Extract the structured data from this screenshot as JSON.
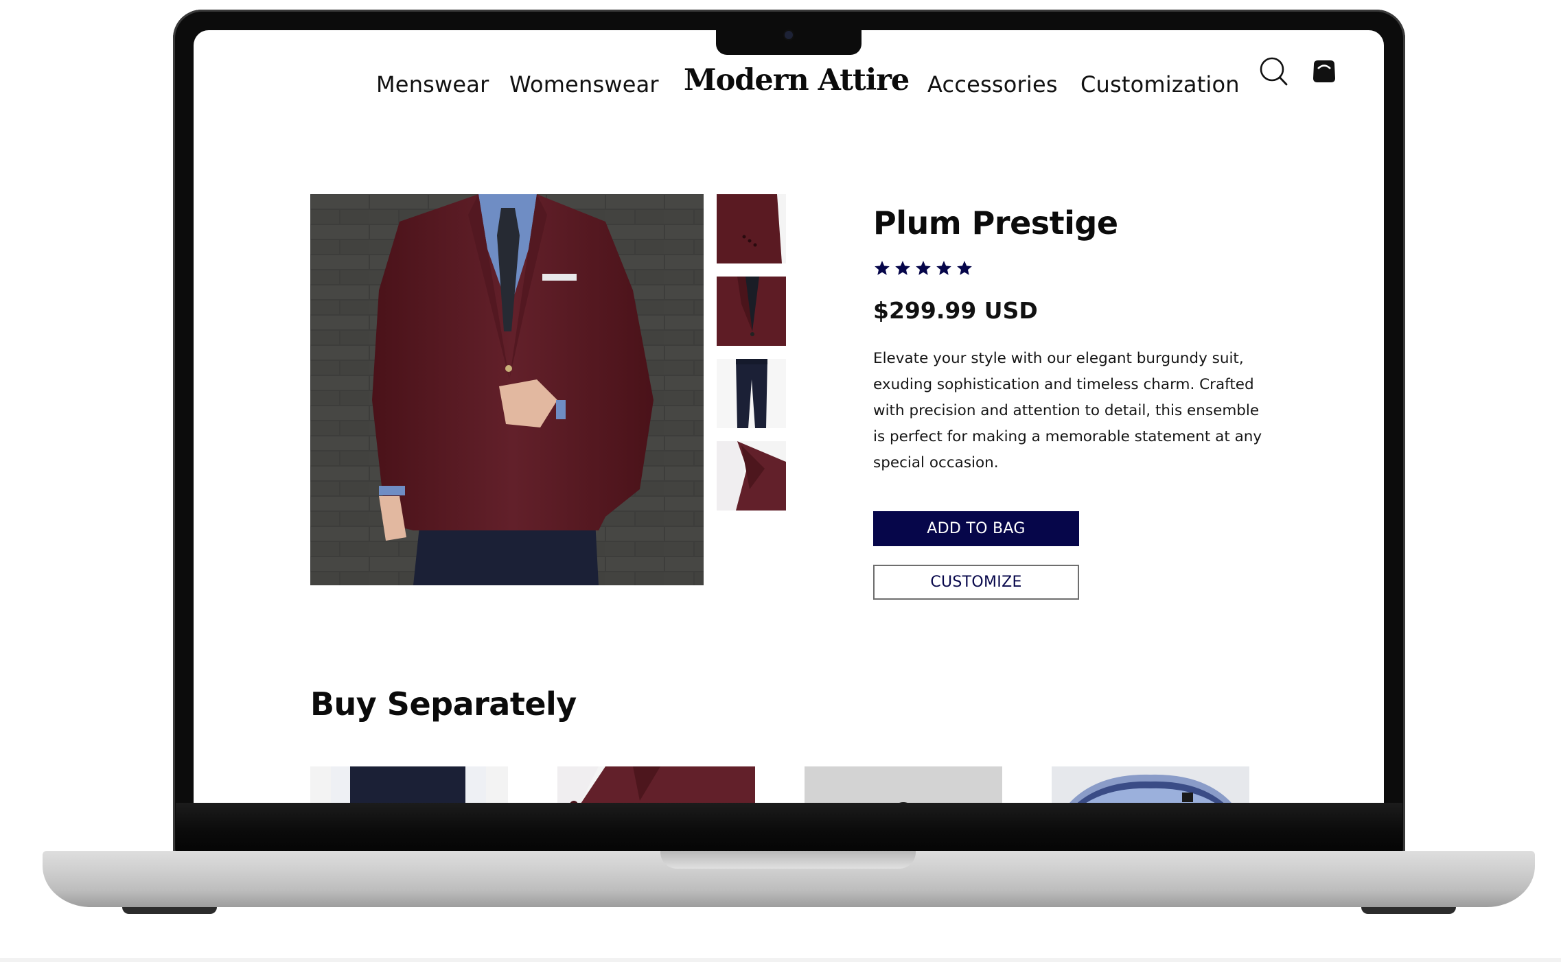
{
  "nav": {
    "links": [
      "Menswear",
      "Womenswear",
      "Accessories",
      "Customization"
    ],
    "logo": "Modern Attire",
    "search_icon": "search-icon",
    "bag_icon": "shopping-bag-icon"
  },
  "product": {
    "title": "Plum Prestige",
    "rating": 5,
    "rating_max": 5,
    "price": "$299.99 USD",
    "description": "Elevate your style with our elegant burgundy suit, exuding sophistication and timeless charm. Crafted with precision and attention to detail, this ensemble is perfect for making a memorable statement at any special occasion.",
    "add_to_bag_label": "ADD TO BAG",
    "customize_label": "CUSTOMIZE"
  },
  "separate": {
    "title": "Buy Separately"
  },
  "colors": {
    "accent": "#06064a",
    "burgundy": "#5a1a22",
    "navy": "#1c2240"
  }
}
